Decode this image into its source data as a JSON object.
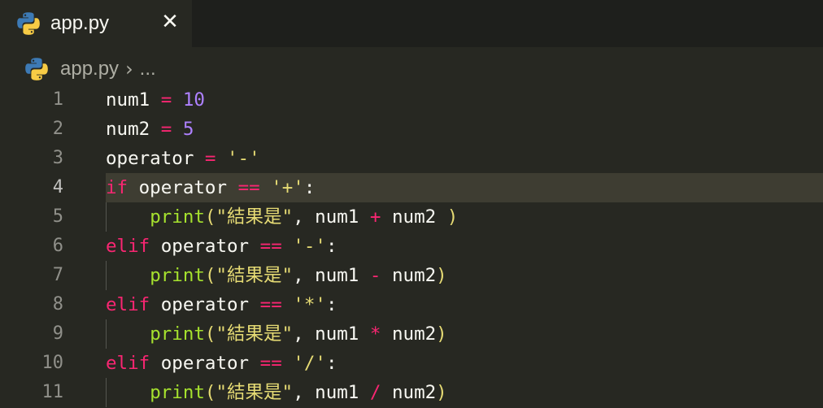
{
  "tab": {
    "icon": "python-file-icon",
    "label": "app.py",
    "close_glyph": "✕"
  },
  "breadcrumb": {
    "icon": "python-file-icon",
    "file": "app.py",
    "separator": "›",
    "more": "..."
  },
  "theme": {
    "background": "#272822",
    "keyword": "#f92672",
    "number": "#ae81ff",
    "string": "#e6db74",
    "function": "#a6e22e",
    "text": "#f8f8f2"
  },
  "editor": {
    "current_line": 4,
    "lines": [
      {
        "number": "1",
        "tokens": [
          "num1",
          " = ",
          "10"
        ]
      },
      {
        "number": "2",
        "tokens": [
          "num2",
          " = ",
          "5"
        ]
      },
      {
        "number": "3",
        "tokens": [
          "operator",
          " = ",
          "'-'"
        ]
      },
      {
        "number": "4",
        "tokens": [
          "if",
          " operator ",
          "==",
          " ",
          "'+'",
          ":"
        ]
      },
      {
        "number": "5",
        "tokens": [
          "    ",
          "print",
          "(",
          "\"結果是\"",
          ", num1 ",
          "+",
          " num2 ",
          ")"
        ]
      },
      {
        "number": "6",
        "tokens": [
          "elif",
          " operator ",
          "==",
          " ",
          "'-'",
          ":"
        ]
      },
      {
        "number": "7",
        "tokens": [
          "    ",
          "print",
          "(",
          "\"結果是\"",
          ", num1 ",
          "-",
          " num2",
          ")"
        ]
      },
      {
        "number": "8",
        "tokens": [
          "elif",
          " operator ",
          "==",
          " ",
          "'*'",
          ":"
        ]
      },
      {
        "number": "9",
        "tokens": [
          "    ",
          "print",
          "(",
          "\"結果是\"",
          ", num1 ",
          "*",
          " num2",
          ")"
        ]
      },
      {
        "number": "10",
        "tokens": [
          "elif",
          " operator ",
          "==",
          " ",
          "'/'",
          ":"
        ]
      },
      {
        "number": "11",
        "tokens": [
          "    ",
          "print",
          "(",
          "\"結果是\"",
          ", num1 ",
          "/",
          " num2",
          ")"
        ]
      }
    ]
  }
}
